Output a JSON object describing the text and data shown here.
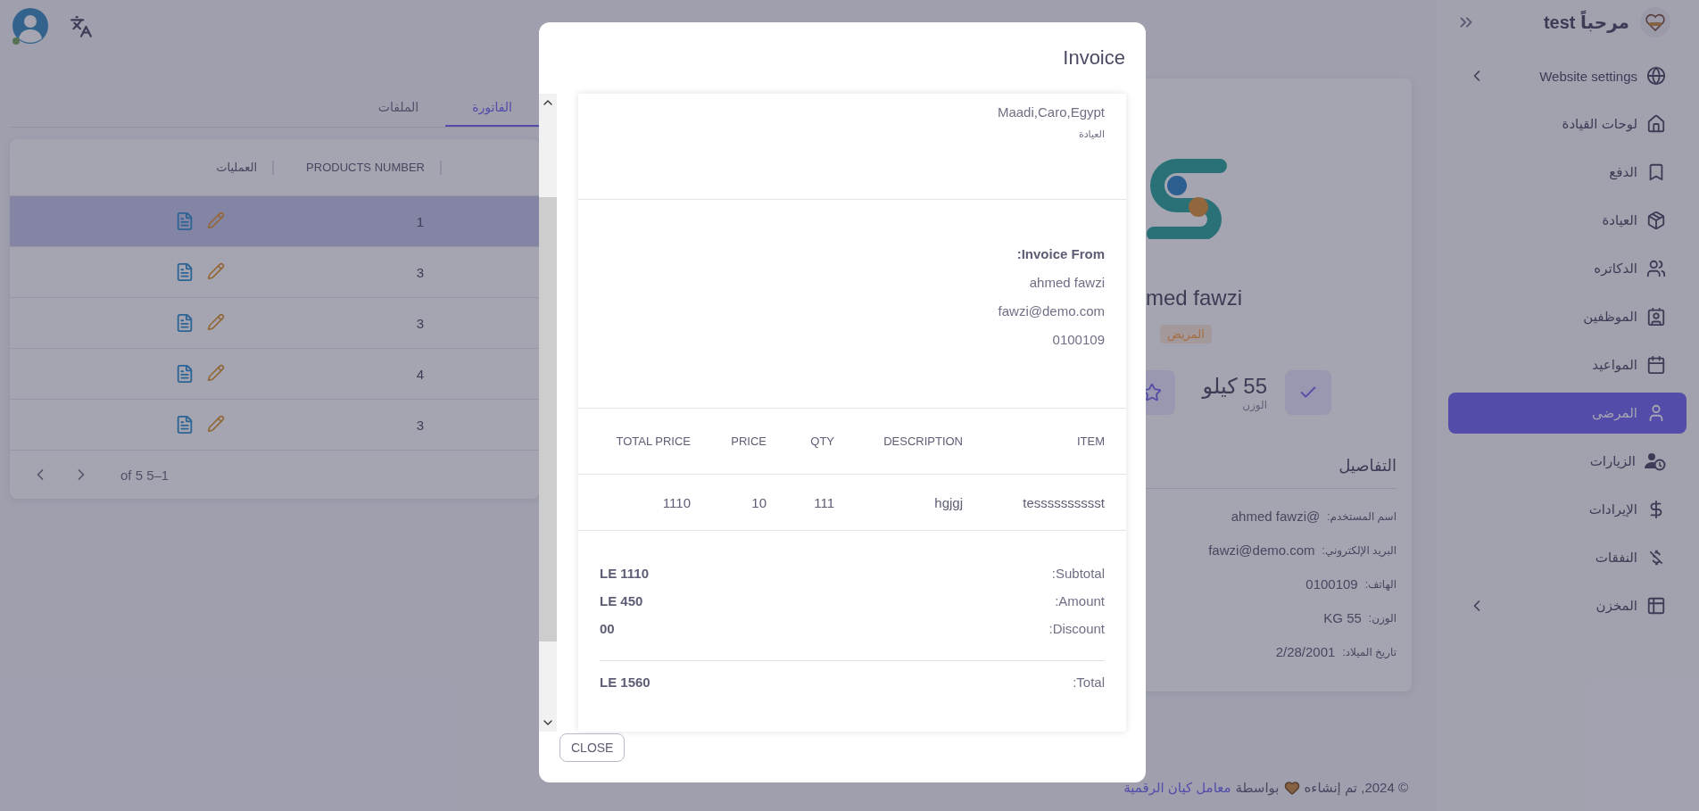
{
  "tabs": [
    {
      "label": "الفاتورة",
      "selected": true
    },
    {
      "label": "الملفات",
      "selected": false
    }
  ],
  "table": {
    "columns": [
      "PRODUCTS NUMBER",
      "العمليات"
    ],
    "rows": [
      {
        "products_number": "1",
        "selected": true
      },
      {
        "products_number": "3",
        "selected": false
      },
      {
        "products_number": "3",
        "selected": false
      },
      {
        "products_number": "4",
        "selected": false
      },
      {
        "products_number": "3",
        "selected": false
      }
    ],
    "pagination": "of 5 5–1"
  },
  "profile": {
    "name": "med fawzi",
    "role": "المريض",
    "stat": {
      "value": "55 كيلو",
      "label": "الوزن"
    },
    "details_title": "التفاصيل",
    "details": [
      {
        "label": "اسم المستخدم:",
        "value": "ahmed fawzi@"
      },
      {
        "label": "البريد الإلكتروني:",
        "value": "fawzi@demo.com"
      },
      {
        "label": "الهاتف:",
        "value": "0100109"
      },
      {
        "label": "الوزن:",
        "value": "KG 55"
      },
      {
        "label": "تاريخ الميلاد:",
        "value": "2/28/2001"
      }
    ]
  },
  "footer": {
    "text": "© 2024, تم إنشاءه",
    "by": "بواسطة",
    "link": "معامل كيان الرقمية"
  },
  "sidebar": {
    "greeting": "مرحباً test",
    "items": [
      {
        "label": "Website settings",
        "expandable": true,
        "selected": false
      },
      {
        "label": "لوحات القيادة",
        "expandable": false,
        "selected": false
      },
      {
        "label": "الدفع",
        "expandable": false,
        "selected": false
      },
      {
        "label": "العيادة",
        "expandable": false,
        "selected": false
      },
      {
        "label": "الدكاتره",
        "expandable": false,
        "selected": false
      },
      {
        "label": "الموظفين",
        "expandable": false,
        "selected": false
      },
      {
        "label": "المواعيد",
        "expandable": false,
        "selected": false
      },
      {
        "label": "المرضى",
        "expandable": false,
        "selected": true
      },
      {
        "label": "الزيارات",
        "expandable": false,
        "selected": false
      },
      {
        "label": "الإيرادات",
        "expandable": false,
        "selected": false
      },
      {
        "label": "النفقات",
        "expandable": false,
        "selected": false
      },
      {
        "label": "المخزن",
        "expandable": true,
        "selected": false
      }
    ]
  },
  "modal": {
    "title": "Invoice",
    "address": "Maadi,Caro,Egypt",
    "clinic": "العيادة",
    "from_title": ":Invoice From",
    "from": [
      "ahmed fawzi",
      "fawzi@demo.com",
      "0100109"
    ],
    "items_table": {
      "columns": [
        "ITEM",
        "DESCRIPTION",
        "QTY",
        "PRICE",
        "TOTAL PRICE"
      ],
      "rows": [
        [
          "tesssssssssst",
          "hgjgj",
          "111",
          "10",
          "1110"
        ]
      ]
    },
    "totals": [
      {
        "label": ":Subtotal",
        "value": "LE 1110"
      },
      {
        "label": ":Amount",
        "value": "LE 450"
      },
      {
        "label": ":Discount",
        "value": "00"
      }
    ],
    "total": {
      "label": ":Total",
      "value": "LE 1560"
    },
    "close": "CLOSE"
  }
}
